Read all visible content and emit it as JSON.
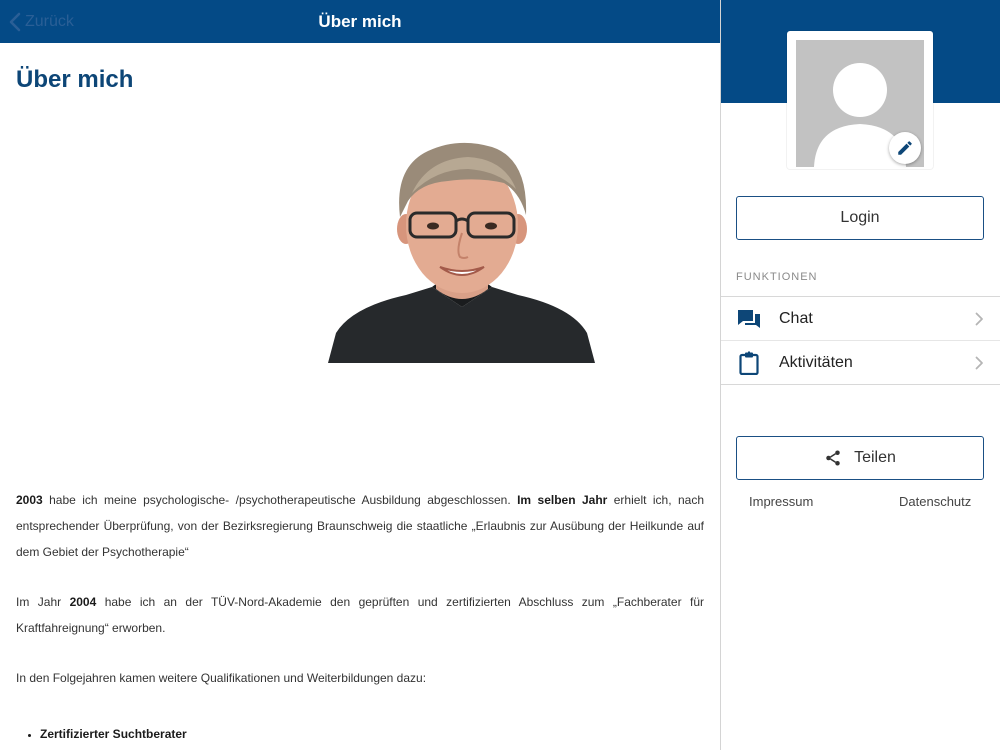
{
  "topbar": {
    "back_label": "Zurück",
    "title": "Über mich"
  },
  "page": {
    "title": "Über mich"
  },
  "article": {
    "paragraph1": {
      "year": "2003",
      "text_a": " habe ich meine psychologische- /psychotherapeutische Ausbildung abgeschlossen. ",
      "emphasis": "Im selben Jahr",
      "text_b": " erhielt ich, nach entsprechender Überprüfung, von der Bezirksregierung Braunschweig die staatliche „Erlaubnis zur Ausübung der Heilkunde auf dem Gebiet der Psychotherapie“"
    },
    "paragraph2": {
      "text_a": "Im Jahr ",
      "year": "2004",
      "text_b": " habe ich an der TÜV-Nord-Akademie den geprüften und zertifizierten Abschluss zum „Fachberater für Kraftfahreignung“ erworben."
    },
    "paragraph3": "In den Folgejahren kamen weitere Qualifikationen und Weiterbildungen dazu:",
    "qualifications": [
      "Zertifizierter Suchtberater"
    ]
  },
  "sidebar": {
    "login_label": "Login",
    "section_label": "FUNKTIONEN",
    "menu": [
      {
        "label": "Chat",
        "icon": "chat-icon"
      },
      {
        "label": "Aktivitäten",
        "icon": "clipboard-icon"
      }
    ],
    "share_label": "Teilen",
    "footer": {
      "impressum": "Impressum",
      "datenschutz": "Datenschutz"
    }
  },
  "colors": {
    "brand": "#044a86",
    "title": "#0d4677",
    "button_border": "#1a4f84",
    "avatar_placeholder": "#c2c2c2"
  }
}
